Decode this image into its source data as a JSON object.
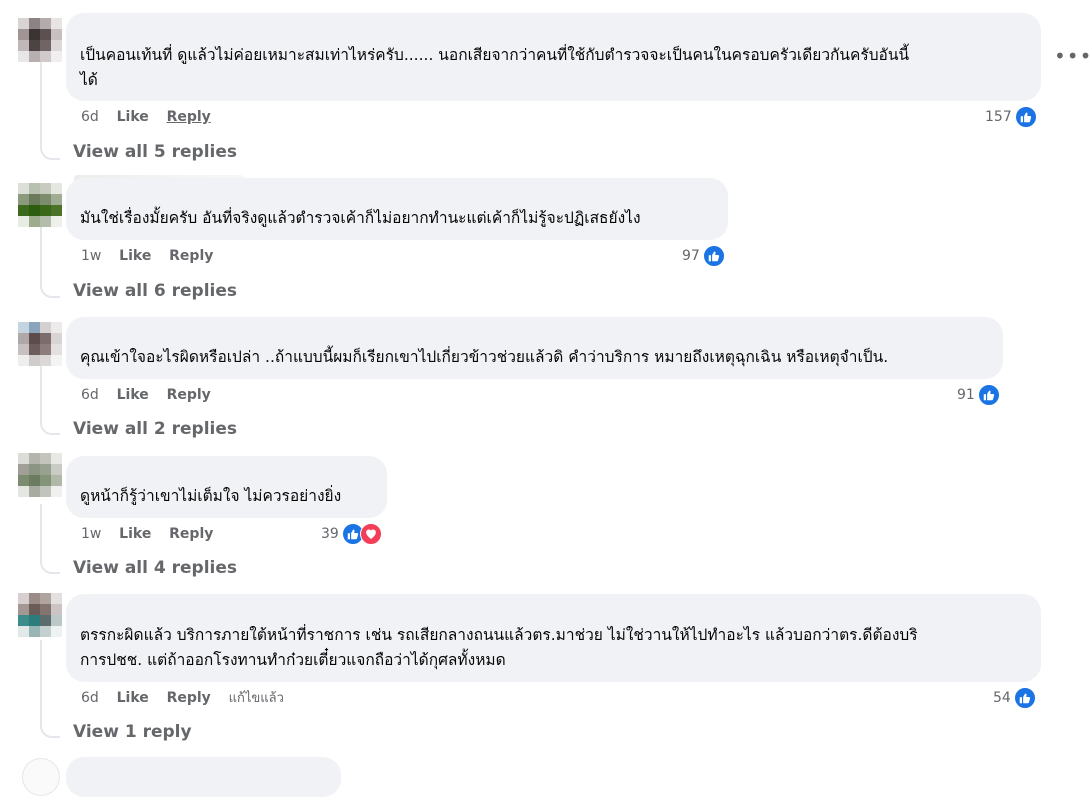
{
  "more_options_icon": "more-horizontal-icon",
  "colors": {
    "like": "#1b74e4",
    "love": "#f33e58",
    "bubble": "#f0f2f5",
    "muted": "#65676b"
  },
  "comments": [
    {
      "text": "เป็นคอนเท้นที่ ดูแล้วไม่ค่อยเหมาะสมเท่าไหร่ครับ...... นอกเสียจากว่าคนที่ใช้กับตำรวจจะเป็นคนในครอบครัวเดียวกันครับอันนี้\nได้",
      "time": "6d",
      "like_label": "Like",
      "reply_label": "Reply",
      "edited": "",
      "reaction_count": "157",
      "reactions": [
        "like"
      ],
      "view_replies": "View all 5 replies"
    },
    {
      "text": "มันใช่เรื่องมั้ยครับ อันที่จริงดูแล้วตำรวจเค้าก็ไม่อยากทำนะแต่เค้าก็ไม่รู้จะปฏิเสธยังไง",
      "time": "1w",
      "like_label": "Like",
      "reply_label": "Reply",
      "edited": "",
      "reaction_count": "97",
      "reactions": [
        "like"
      ],
      "view_replies": "View all 6 replies"
    },
    {
      "text": "คุณเข้าใจอะไรผิดหรือเปล่า ..ถ้าแบบนี้ผมก็เรียกเขาไปเกี่ยวข้าวช่วยแล้วดิ คำว่าบริการ หมายถึงเหตุฉุกเฉิน หรือเหตุจำเป็น.",
      "time": "6d",
      "like_label": "Like",
      "reply_label": "Reply",
      "edited": "",
      "reaction_count": "91",
      "reactions": [
        "like"
      ],
      "view_replies": "View all 2 replies"
    },
    {
      "text": "ดูหน้าก็รู้ว่าเขาไม่เต็มใจ ไม่ควรอย่างยิ่ง",
      "time": "1w",
      "like_label": "Like",
      "reply_label": "Reply",
      "edited": "",
      "reaction_count": "39",
      "reactions": [
        "like",
        "love"
      ],
      "view_replies": "View all 4 replies"
    },
    {
      "text": "ตรรกะผิดแล้ว บริการภายใต้หน้าที่ราชการ เช่น รถเสียกลางถนนแล้วตร.มาช่วย ไม่ใช่วานให้ไปทำอะไร แล้วบอกว่าตร.ดีต้องบริ\nการปชช. แต่ถ้าออกโรงทานทำก๋วยเตี๋ยวแจกถือว่าได้กุศลทั้งหมด",
      "time": "6d",
      "like_label": "Like",
      "reply_label": "Reply",
      "edited": "แก้ไขแล้ว",
      "reaction_count": "54",
      "reactions": [
        "like"
      ],
      "view_replies": "View 1 reply"
    }
  ]
}
